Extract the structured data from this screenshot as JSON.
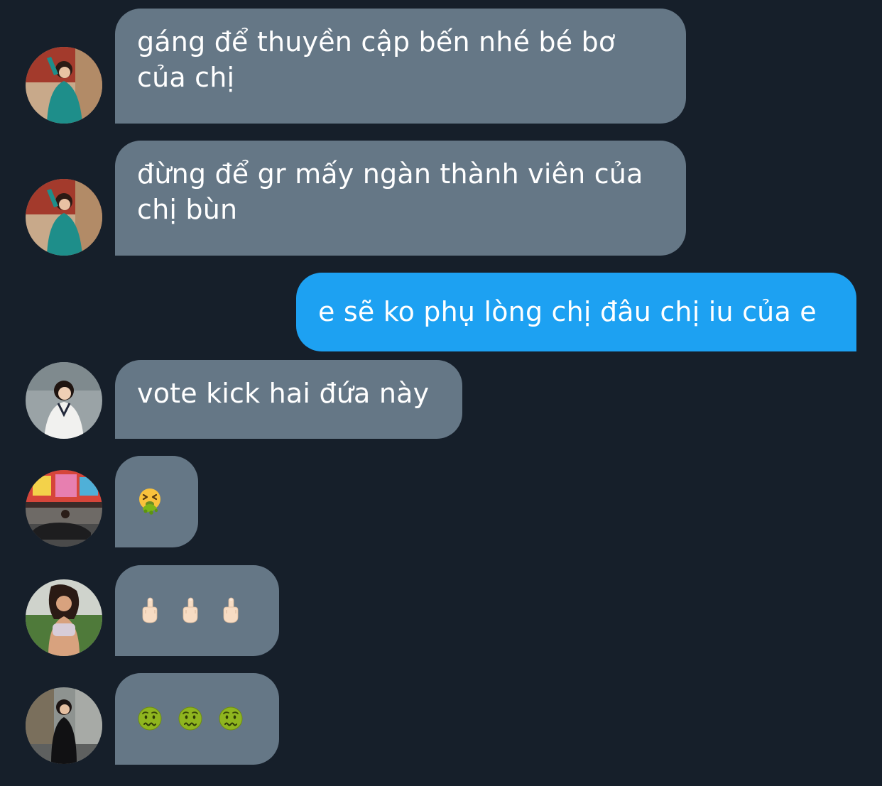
{
  "colors": {
    "background": "#161f2a",
    "incoming_bubble": "#657786",
    "outgoing_bubble": "#1da1f2",
    "text": "#ffffff"
  },
  "messages": [
    {
      "direction": "incoming",
      "sender_avatar": "avatar-woman-teal-dress",
      "text": "gáng để thuyền cập bến nhé bé bơ của chị"
    },
    {
      "direction": "incoming",
      "sender_avatar": "avatar-woman-teal-dress",
      "text": "đừng để gr mấy ngàn thành viên của chị bùn"
    },
    {
      "direction": "outgoing",
      "text": "e sẽ ko phụ lòng chị đâu chị iu của e"
    },
    {
      "direction": "incoming",
      "sender_avatar": "avatar-woman-white-sweater",
      "text": "vote kick hai đứa này"
    },
    {
      "direction": "incoming",
      "sender_avatar": "avatar-street-scene",
      "emoji": [
        "vomiting-face-icon"
      ]
    },
    {
      "direction": "incoming",
      "sender_avatar": "avatar-woman-sports-top",
      "emoji": [
        "middle-finger-icon",
        "middle-finger-icon",
        "middle-finger-icon"
      ]
    },
    {
      "direction": "incoming",
      "sender_avatar": "avatar-woman-black-outfit",
      "emoji": [
        "nauseated-face-icon",
        "nauseated-face-icon",
        "nauseated-face-icon"
      ]
    }
  ]
}
